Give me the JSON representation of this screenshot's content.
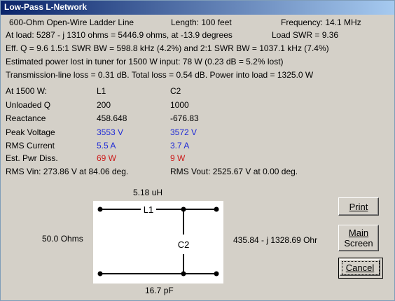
{
  "window": {
    "title": "Low-Pass L-Network"
  },
  "summary": {
    "line_type": "600-Ohm Open-Wire Ladder Line",
    "length": "Length:  100 feet",
    "frequency": "Frequency:  14.1 MHz",
    "at_load": "At load:  5287 - j  1310 ohms = 5446.9 ohms, at -13.9 degrees",
    "load_swr": "Load SWR =  9.36",
    "eff_q": "Eff. Q = 9.6    1.5:1 SWR BW = 598.8 kHz (4.2%) and 2:1 SWR BW = 1037.1 kHz (7.4%)",
    "power_lost": "Estimated power lost in tuner for 1500 W input:   78 W (0.23 dB = 5.2% lost)",
    "losses": "Transmission-line loss = 0.31 dB.  Total loss = 0.54 dB.  Power into load = 1325.0 W"
  },
  "table": {
    "header": [
      "At 1500 W:",
      "L1",
      "C2"
    ],
    "rows": [
      {
        "label": "Unloaded Q",
        "l1": "200",
        "c2": "1000"
      },
      {
        "label": "Reactance",
        "l1": "458.648",
        "c2": "-676.83"
      },
      {
        "label": "Peak Voltage",
        "l1": "3553 V",
        "c2": "3572 V"
      },
      {
        "label": "RMS Current",
        "l1": "5.5 A",
        "c2": "3.7 A"
      },
      {
        "label": "Est. Pwr Diss.",
        "l1": "69 W",
        "c2": "9 W"
      }
    ],
    "rms_vin": "RMS Vin:   273.86 V at 84.06 deg.",
    "rms_vout": "RMS Vout:  2525.67 V at 0.00 deg."
  },
  "schematic": {
    "inductance": "5.18 uH",
    "l1_label": "L1",
    "c2_label": "C2",
    "capacitance": "16.7 pF",
    "source_impedance": "50.0 Ohms",
    "load_impedance": "435.84 - j 1328.69 Ohr"
  },
  "buttons": {
    "print": "Print",
    "main_screen_line1": "Main",
    "main_screen_line2": "Screen",
    "cancel": "Cancel"
  }
}
